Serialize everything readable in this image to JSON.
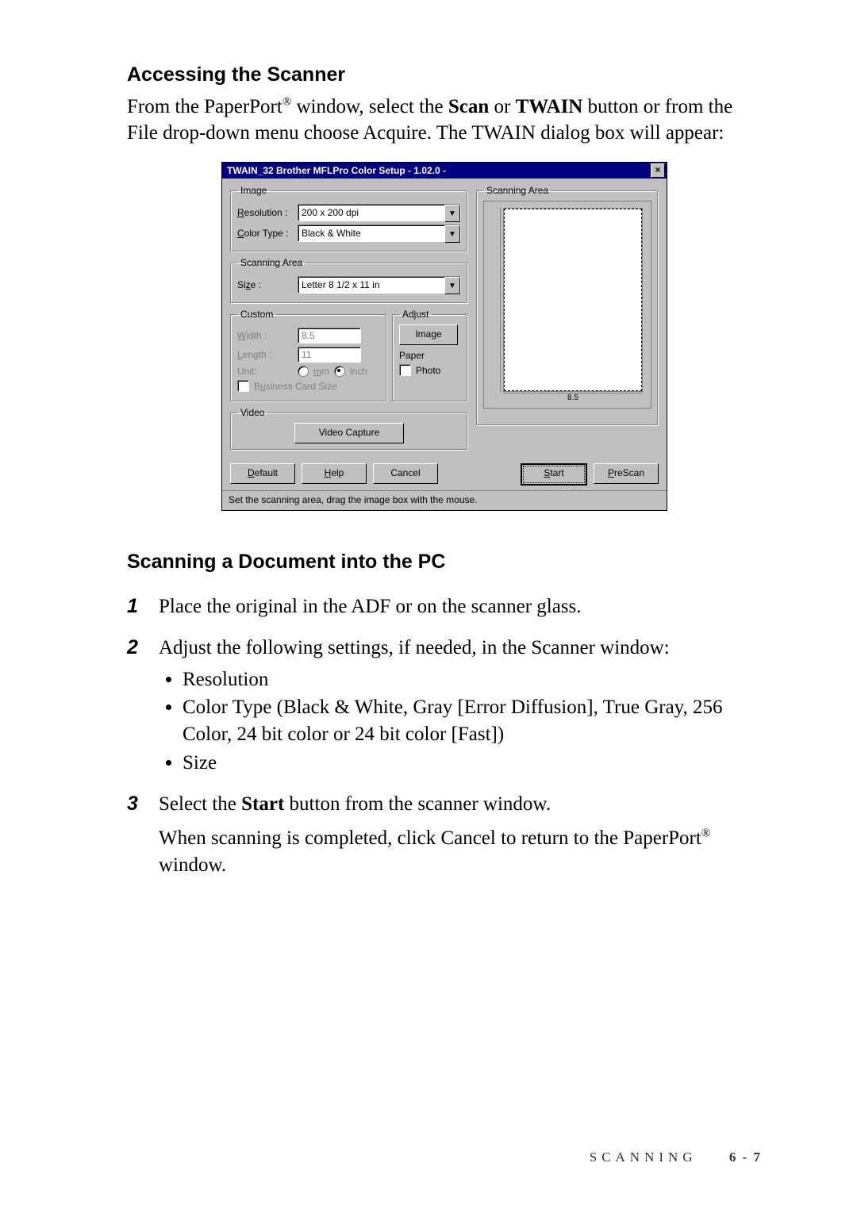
{
  "section1": {
    "heading": "Accessing the Scanner",
    "para_pre": "From the PaperPort",
    "reg1": "®",
    "para_mid1": " window, select the ",
    "scan": "Scan",
    "para_or": " or ",
    "twain": "TWAIN",
    "para_post": " button or from the File drop-down menu choose Acquire. The TWAIN dialog box will appear:"
  },
  "dialog": {
    "title": "TWAIN_32 Brother MFLPro Color Setup - 1.02.0 -",
    "close": "×",
    "image_group": "Image",
    "resolution_label_u": "R",
    "resolution_label_rest": "esolution :",
    "resolution_value": "200 x 200 dpi",
    "colortype_label_u": "C",
    "colortype_label_rest": "olor Type :",
    "colortype_value": "Black & White",
    "scanningarea_group": "Scanning Area",
    "size_label_pre": "Si",
    "size_label_u": "z",
    "size_label_post": "e :",
    "size_value": "Letter 8 1/2 x 11 in",
    "custom_group": "Custom",
    "width_label_u": "W",
    "width_label_rest": "idth :",
    "width_value": "8.5",
    "length_label_u": "L",
    "length_label_rest": "ength :",
    "length_value": "11",
    "unit_label": "Unit:",
    "unit_mm_u": "m",
    "unit_mm_rest": "m",
    "unit_inch": "inch",
    "businesscard_pre": "B",
    "businesscard_u": "u",
    "businesscard_post": "siness Card Size",
    "adjust_group": "Adjust",
    "adjust_image": "Image",
    "adjust_paper": "Paper",
    "adjust_photo": "Photo",
    "video_group": "Video",
    "video_capture": "Video Capture",
    "preview_group": "Scanning Area",
    "ruler_value": "8.5",
    "btn_default_u": "D",
    "btn_default_rest": "efault",
    "btn_help_u": "H",
    "btn_help_rest": "elp",
    "btn_cancel": "Cancel",
    "btn_start_u": "S",
    "btn_start_rest": "tart",
    "btn_prescan_u": "P",
    "btn_prescan_rest": "reScan",
    "status": "Set the scanning area, drag the image box with the mouse."
  },
  "section2": {
    "heading": "Scanning a Document into the PC",
    "steps": {
      "s1_num": "1",
      "s1_text": "Place the original in the ADF or on the scanner glass.",
      "s2_num": "2",
      "s2_text": "Adjust the following settings, if needed, in the Scanner window:",
      "s2_b1": "Resolution",
      "s2_b2": "Color Type (Black & White, Gray [Error Diffusion], True Gray, 256 Color, 24 bit color or 24 bit color [Fast])",
      "s2_b3": "Size",
      "s3_num": "3",
      "s3_pre": "Select the ",
      "s3_start": "Start",
      "s3_post": " button from the scanner window.",
      "s3_para2_pre": "When scanning is completed, click Cancel to return to the PaperPort",
      "s3_reg": "®",
      "s3_para2_post": " window."
    }
  },
  "footer": {
    "label": "SCANNING",
    "page": "6 - 7"
  }
}
